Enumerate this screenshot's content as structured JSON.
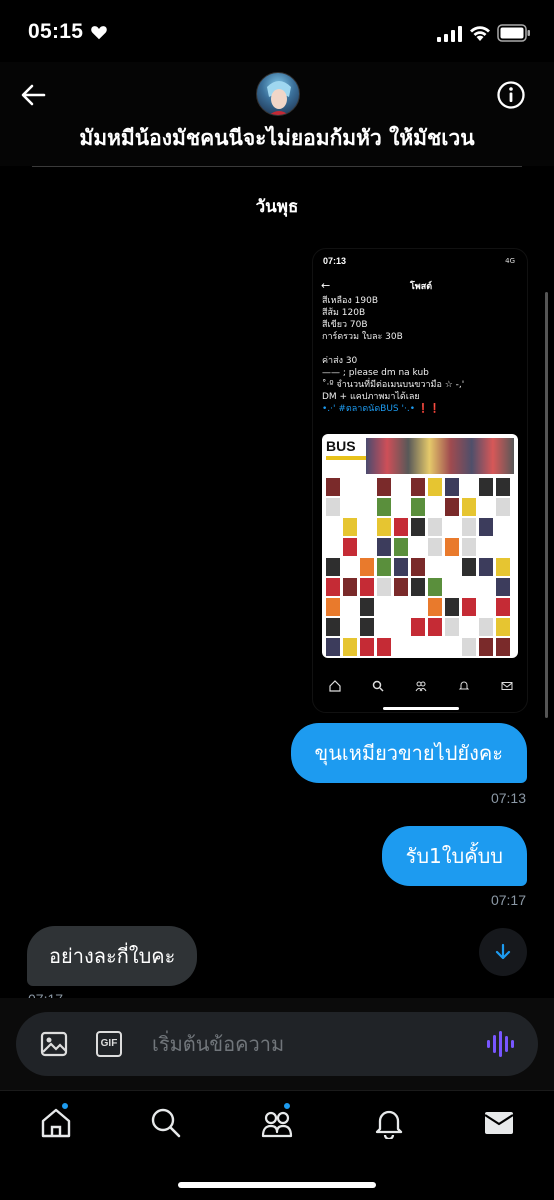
{
  "status_bar": {
    "time": "05:15",
    "icons": [
      "heart-icon",
      "signal-icon",
      "wifi-icon",
      "battery-icon"
    ]
  },
  "header": {
    "title": "มัมหมีน้องมัชคนนีจะไม่ยอมก้มหัว ให้มัชเวน",
    "back_icon": "arrow-left-icon",
    "info_icon": "info-icon"
  },
  "date_divider": "วันพุธ",
  "shared_image": {
    "status_time": "07:13",
    "status_right": "4G",
    "title": "โพสต์",
    "lines": [
      "สีเหลือง 190B",
      "สีส้ม 120B",
      "สีเขียว 70B",
      "การ์ดรวม ใบละ 30B",
      "",
      "ค่าส่ง 30",
      "—— ; please dm na kub",
      "˚‧º จำนวนที่มีต่อเมนบนขวามือ ☆ -,'",
      "DM + แคปภาพมาได้เลย",
      "•.·' #ตลาดนัดBUS '·.• ❗❗"
    ],
    "photocard_logo": "BUS"
  },
  "messages": [
    {
      "direction": "out",
      "text": "ขุนเหมียวขายไปยังคะ",
      "time": "07:13"
    },
    {
      "direction": "out",
      "text": "รับ1ใบคั้บบ",
      "time": "07:17"
    },
    {
      "direction": "in",
      "text": "อย่างละกี่ใบคะ",
      "time": "07:17"
    }
  ],
  "composer": {
    "placeholder": "เริ่มต้นข้อความ",
    "gif_label": "GIF",
    "accent_color": "#7856ff"
  },
  "tabs": [
    {
      "name": "home",
      "icon": "home-icon",
      "has_dot": true
    },
    {
      "name": "search",
      "icon": "search-icon",
      "has_dot": false
    },
    {
      "name": "communities",
      "icon": "people-icon",
      "has_dot": true
    },
    {
      "name": "notifications",
      "icon": "bell-icon",
      "has_dot": false
    },
    {
      "name": "messages",
      "icon": "mail-icon",
      "has_dot": false
    }
  ],
  "colors": {
    "accent": "#1d9bf0",
    "incoming_bubble": "#2f3336",
    "background": "#000000"
  }
}
